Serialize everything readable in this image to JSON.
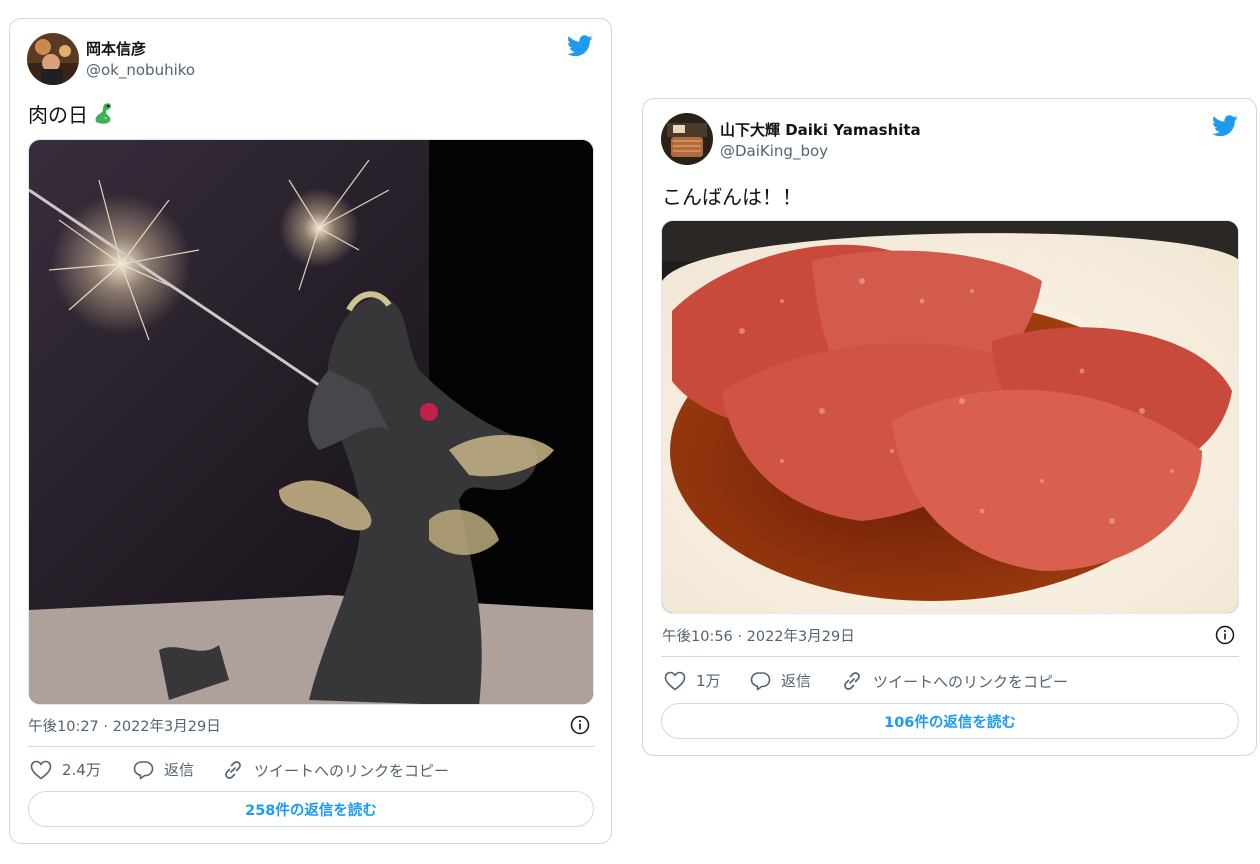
{
  "colors": {
    "accent": "#1d9bf0",
    "secondary_text": "#536471",
    "border": "#cfd9de"
  },
  "tweets": [
    {
      "author_name": "岡本信彦",
      "handle": "@ok_nobuhiko",
      "text": "肉の日",
      "emoji_icon": "dragon-emoji",
      "media_description": "glass dragon sculpture with sparklers",
      "timestamp": "午後10:27 · 2022年3月29日",
      "actions": {
        "likes": "2.4万",
        "reply": "返信",
        "copy_link": "ツイートへのリンクをコピー"
      },
      "read_replies": "258件の返信を読む"
    },
    {
      "author_name": "山下大輝 Daiki Yamashita",
      "handle": "@DaiKing_boy",
      "text": "こんばんは！！",
      "media_description": "marbled wagyu beef slices in sauce",
      "timestamp": "午後10:56 · 2022年3月29日",
      "actions": {
        "likes": "1万",
        "reply": "返信",
        "copy_link": "ツイートへのリンクをコピー"
      },
      "read_replies": "106件の返信を読む"
    }
  ]
}
